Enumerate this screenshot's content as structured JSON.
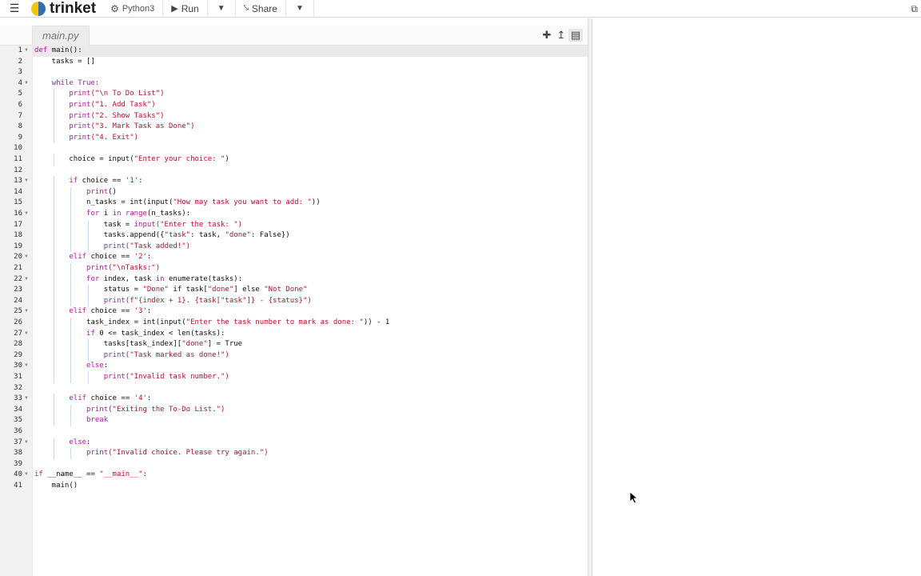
{
  "topbar": {
    "menu_icon": "hamburger-icon",
    "brand": "trinket",
    "language": "Python3",
    "run_label": "Run",
    "share_label": "Share"
  },
  "editor": {
    "file_tab": "main.py",
    "tools": [
      "plus-icon",
      "upload-icon",
      "save-icon"
    ],
    "lines": [
      [
        {
          "t": "def ",
          "c": "kw"
        },
        {
          "t": "main():",
          "c": "id"
        }
      ],
      [
        {
          "t": "    tasks = []",
          "c": "id"
        }
      ],
      [],
      [
        {
          "t": "    ",
          "c": "id"
        },
        {
          "t": "while True:",
          "c": "kw"
        }
      ],
      [
        {
          "t": "        ",
          "c": "id"
        },
        {
          "t": "print",
          "c": "kw"
        },
        {
          "t": "(\"\\n To Do List\")",
          "c": "str"
        }
      ],
      [
        {
          "t": "        ",
          "c": "id"
        },
        {
          "t": "print",
          "c": "kw"
        },
        {
          "t": "(\"1. Add Task\")",
          "c": "str"
        }
      ],
      [
        {
          "t": "        ",
          "c": "id"
        },
        {
          "t": "print",
          "c": "kw"
        },
        {
          "t": "(\"2. Show Tasks\")",
          "c": "str"
        }
      ],
      [
        {
          "t": "        ",
          "c": "id"
        },
        {
          "t": "print",
          "c": "kw"
        },
        {
          "t": "(\"3. Mark Task as Done\")",
          "c": "str"
        }
      ],
      [
        {
          "t": "        ",
          "c": "id"
        },
        {
          "t": "print",
          "c": "kw"
        },
        {
          "t": "(\"4. Exit\")",
          "c": "str"
        }
      ],
      [],
      [
        {
          "t": "        choice = input(",
          "c": "id"
        },
        {
          "t": "\"Enter your choice: \"",
          "c": "str"
        },
        {
          "t": ")",
          "c": "id"
        }
      ],
      [],
      [
        {
          "t": "        ",
          "c": "id"
        },
        {
          "t": "if",
          "c": "kw"
        },
        {
          "t": " choice == ",
          "c": "id"
        },
        {
          "t": "'1'",
          "c": "str"
        },
        {
          "t": ":",
          "c": "id"
        }
      ],
      [
        {
          "t": "            ",
          "c": "id"
        },
        {
          "t": "print",
          "c": "kw"
        },
        {
          "t": "()",
          "c": "id"
        }
      ],
      [
        {
          "t": "            n_tasks = int(input(",
          "c": "id"
        },
        {
          "t": "\"How may task you want to add: \"",
          "c": "str"
        },
        {
          "t": "))",
          "c": "id"
        }
      ],
      [
        {
          "t": "            ",
          "c": "id"
        },
        {
          "t": "for",
          "c": "kw"
        },
        {
          "t": " i ",
          "c": "id"
        },
        {
          "t": "in",
          "c": "kw"
        },
        {
          "t": " ",
          "c": "id"
        },
        {
          "t": "range",
          "c": "kw"
        },
        {
          "t": "(n_tasks):",
          "c": "id"
        }
      ],
      [
        {
          "t": "                task = ",
          "c": "id"
        },
        {
          "t": "input",
          "c": "kw"
        },
        {
          "t": "(\"Enter the task: \")",
          "c": "str"
        }
      ],
      [
        {
          "t": "                tasks.append({",
          "c": "id"
        },
        {
          "t": "\"task\"",
          "c": "str"
        },
        {
          "t": ": task, ",
          "c": "id"
        },
        {
          "t": "\"done\"",
          "c": "str"
        },
        {
          "t": ": False})",
          "c": "id"
        }
      ],
      [
        {
          "t": "                ",
          "c": "id"
        },
        {
          "t": "print",
          "c": "kw"
        },
        {
          "t": "(\"Task added!\")",
          "c": "str"
        }
      ],
      [
        {
          "t": "        ",
          "c": "id"
        },
        {
          "t": "elif",
          "c": "kw"
        },
        {
          "t": " choice == ",
          "c": "id"
        },
        {
          "t": "'2'",
          "c": "str"
        },
        {
          "t": ":",
          "c": "id"
        }
      ],
      [
        {
          "t": "            ",
          "c": "id"
        },
        {
          "t": "print",
          "c": "kw"
        },
        {
          "t": "(\"\\nTasks:\")",
          "c": "str"
        }
      ],
      [
        {
          "t": "            ",
          "c": "id"
        },
        {
          "t": "for",
          "c": "kw"
        },
        {
          "t": " index, task ",
          "c": "id"
        },
        {
          "t": "in",
          "c": "kw"
        },
        {
          "t": " enumerate(tasks):",
          "c": "id"
        }
      ],
      [
        {
          "t": "                status = ",
          "c": "id"
        },
        {
          "t": "\"Done\"",
          "c": "str"
        },
        {
          "t": " if task[",
          "c": "id"
        },
        {
          "t": "\"done\"",
          "c": "str"
        },
        {
          "t": "] else ",
          "c": "id"
        },
        {
          "t": "\"Not Done\"",
          "c": "str"
        }
      ],
      [
        {
          "t": "                ",
          "c": "id"
        },
        {
          "t": "print",
          "c": "kw"
        },
        {
          "t": "(f\"{index + 1}. {task[\"task\"]} - {status}\")",
          "c": "str"
        }
      ],
      [
        {
          "t": "        ",
          "c": "id"
        },
        {
          "t": "elif",
          "c": "kw"
        },
        {
          "t": " choice == ",
          "c": "id"
        },
        {
          "t": "'3'",
          "c": "str"
        },
        {
          "t": ":",
          "c": "id"
        }
      ],
      [
        {
          "t": "            task_index = int(input(",
          "c": "id"
        },
        {
          "t": "\"Enter the task number to mark as done: \"",
          "c": "str"
        },
        {
          "t": ")) - 1",
          "c": "id"
        }
      ],
      [
        {
          "t": "            ",
          "c": "id"
        },
        {
          "t": "if",
          "c": "kw"
        },
        {
          "t": " 0 <= task_index < len(tasks):",
          "c": "id"
        }
      ],
      [
        {
          "t": "                tasks[task_index][",
          "c": "id"
        },
        {
          "t": "\"done\"",
          "c": "str"
        },
        {
          "t": "] = True",
          "c": "id"
        }
      ],
      [
        {
          "t": "                ",
          "c": "id"
        },
        {
          "t": "print",
          "c": "kw"
        },
        {
          "t": "(\"Task marked as done!\")",
          "c": "str"
        }
      ],
      [
        {
          "t": "            ",
          "c": "id"
        },
        {
          "t": "else",
          "c": "kw"
        },
        {
          "t": ":",
          "c": "id"
        }
      ],
      [
        {
          "t": "                ",
          "c": "id"
        },
        {
          "t": "print",
          "c": "kw"
        },
        {
          "t": "(\"Invalid task number.\")",
          "c": "str"
        }
      ],
      [],
      [
        {
          "t": "        ",
          "c": "id"
        },
        {
          "t": "elif",
          "c": "kw"
        },
        {
          "t": " choice == ",
          "c": "id"
        },
        {
          "t": "'4'",
          "c": "str"
        },
        {
          "t": ":",
          "c": "id"
        }
      ],
      [
        {
          "t": "            ",
          "c": "id"
        },
        {
          "t": "print",
          "c": "kw"
        },
        {
          "t": "(\"Exiting the To-Do List.\")",
          "c": "str"
        }
      ],
      [
        {
          "t": "            ",
          "c": "id"
        },
        {
          "t": "break",
          "c": "kw"
        }
      ],
      [],
      [
        {
          "t": "        ",
          "c": "id"
        },
        {
          "t": "else",
          "c": "kw"
        },
        {
          "t": ":",
          "c": "id"
        }
      ],
      [
        {
          "t": "            ",
          "c": "id"
        },
        {
          "t": "print",
          "c": "kw"
        },
        {
          "t": "(\"Invalid choice. Please try again.\")",
          "c": "str"
        }
      ],
      [],
      [
        {
          "t": "if",
          "c": "kw"
        },
        {
          "t": " __name__ == ",
          "c": "id"
        },
        {
          "t": "\"__main__\"",
          "c": "str"
        },
        {
          "t": ":",
          "c": "id"
        }
      ],
      [
        {
          "t": "    main()",
          "c": "id"
        }
      ]
    ],
    "fold_lines": [
      1,
      4,
      13,
      16,
      20,
      22,
      25,
      27,
      30,
      33,
      37,
      40
    ]
  },
  "colors": {
    "keyword": "#b01aa3",
    "string": "#c40d2a",
    "logo_yellow": "#f7c600",
    "logo_blue": "#2f6fb5"
  }
}
